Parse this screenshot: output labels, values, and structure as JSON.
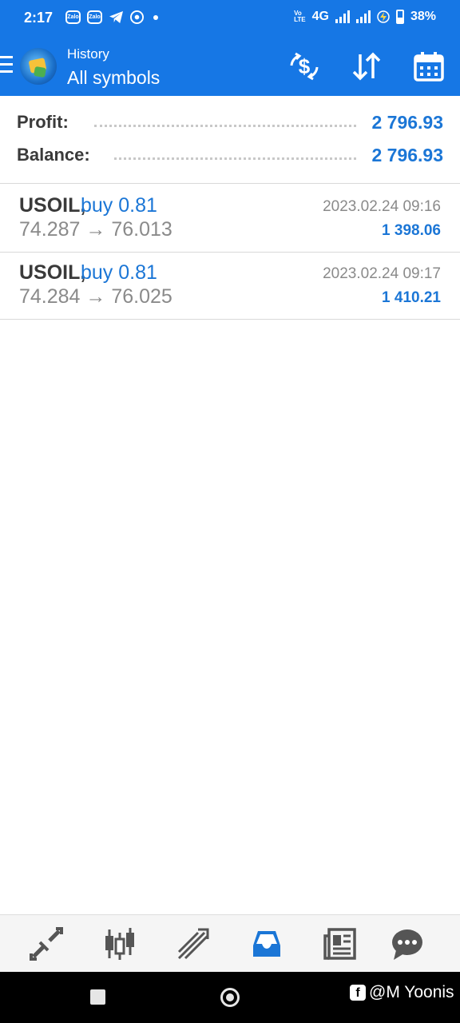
{
  "status_bar": {
    "time": "2:17",
    "zalo_label": "Zalo",
    "network": "4G",
    "battery": "38%"
  },
  "app_bar": {
    "subtitle": "History",
    "title": "All symbols",
    "actions": [
      "currency-exchange-icon",
      "sort-icon",
      "calendar-icon"
    ]
  },
  "summary": {
    "profit_label": "Profit:",
    "profit_value": "2 796.93",
    "balance_label": "Balance:",
    "balance_value": "2 796.93"
  },
  "deals": [
    {
      "symbol": "USOIL,",
      "side": "buy 0.81",
      "prices": "74.287 → 76.013",
      "datetime": "2023.02.24 09:16",
      "profit": "1 398.06"
    },
    {
      "symbol": "USOIL,",
      "side": "buy 0.81",
      "prices": "74.284 → 76.025",
      "datetime": "2023.02.24 09:17",
      "profit": "1 410.21"
    }
  ],
  "tabs": [
    {
      "name": "quotes-icon",
      "active": false
    },
    {
      "name": "chart-candles-icon",
      "active": false
    },
    {
      "name": "trade-icon",
      "active": false
    },
    {
      "name": "history-inbox-icon",
      "active": true
    },
    {
      "name": "news-icon",
      "active": false
    },
    {
      "name": "messages-icon",
      "active": false
    }
  ],
  "colors": {
    "accent": "#1677e5",
    "value_blue": "#1b76d6",
    "text_dark": "#3a3a3a",
    "text_gray": "#8a8a8a"
  },
  "watermark": "@M Yoonis"
}
